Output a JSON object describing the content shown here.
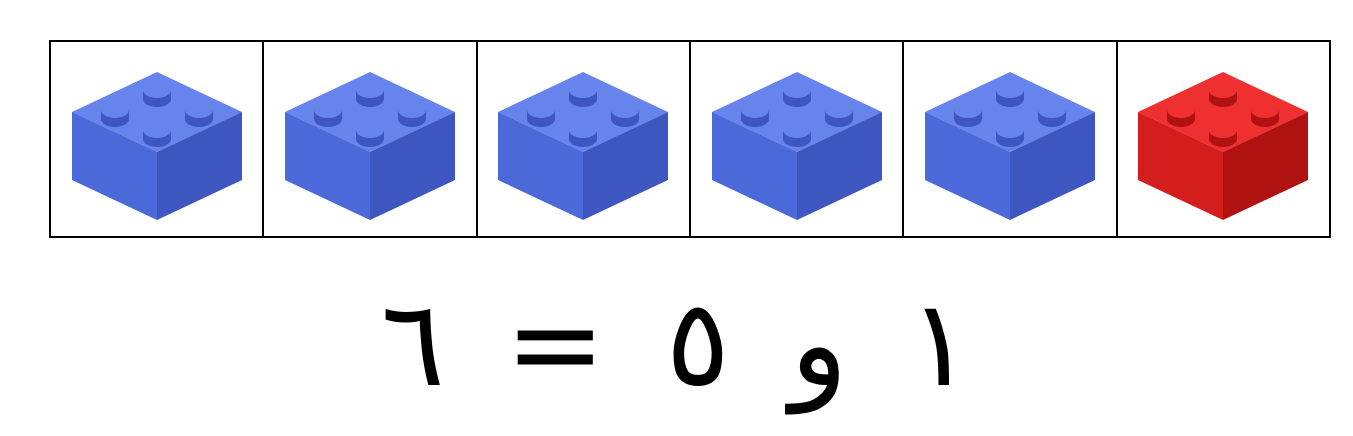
{
  "bricks": [
    {
      "color": "blue",
      "fill": "#4b69d9",
      "top": "#6684ec",
      "side": "#3d56c0",
      "icon": "lego-brick-2x2-icon"
    },
    {
      "color": "blue",
      "fill": "#4b69d9",
      "top": "#6684ec",
      "side": "#3d56c0",
      "icon": "lego-brick-2x2-icon"
    },
    {
      "color": "blue",
      "fill": "#4b69d9",
      "top": "#6684ec",
      "side": "#3d56c0",
      "icon": "lego-brick-2x2-icon"
    },
    {
      "color": "blue",
      "fill": "#4b69d9",
      "top": "#6684ec",
      "side": "#3d56c0",
      "icon": "lego-brick-2x2-icon"
    },
    {
      "color": "blue",
      "fill": "#4b69d9",
      "top": "#6684ec",
      "side": "#3d56c0",
      "icon": "lego-brick-2x2-icon"
    },
    {
      "color": "red",
      "fill": "#d41d1d",
      "top": "#ee3030",
      "side": "#b01212",
      "icon": "lego-brick-2x2-icon"
    }
  ],
  "equation": {
    "first": "١",
    "conj": "و",
    "second": "٥",
    "equals": "=",
    "result": "٦"
  }
}
